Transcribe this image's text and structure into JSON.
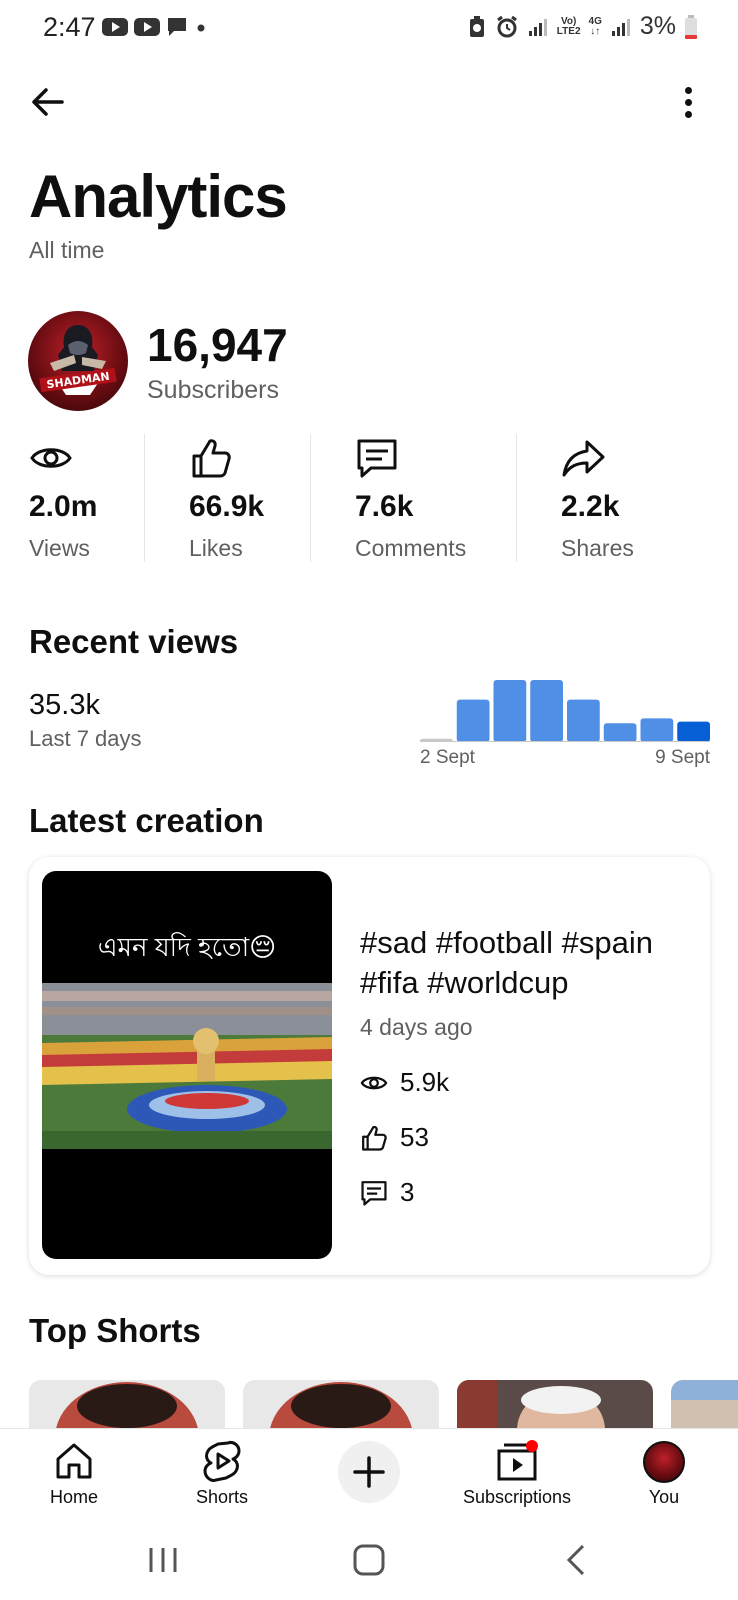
{
  "status_bar": {
    "time": "2:47",
    "battery": "3%",
    "net_volte": "Vo)",
    "net_lte": "LTE2",
    "net_4g": "4G"
  },
  "header": {
    "title": "Analytics",
    "subtitle": "All time"
  },
  "channel": {
    "subscribers": "16,947",
    "subscribers_label": "Subscribers",
    "avatar_text": "SHADMAN"
  },
  "stats": [
    {
      "value": "2.0m",
      "label": "Views",
      "icon": "eye-icon"
    },
    {
      "value": "66.9k",
      "label": "Likes",
      "icon": "thumbs-up-icon"
    },
    {
      "value": "7.6k",
      "label": "Comments",
      "icon": "comment-icon"
    },
    {
      "value": "2.2k",
      "label": "Shares",
      "icon": "share-icon"
    }
  ],
  "recent_views": {
    "title": "Recent views",
    "value": "35.3k",
    "period": "Last 7 days",
    "axis_start": "2 Sept",
    "axis_end": "9 Sept"
  },
  "chart_data": {
    "type": "bar",
    "categories": [
      "2 Sept",
      "3 Sept",
      "4 Sept",
      "5 Sept",
      "6 Sept",
      "7 Sept",
      "8 Sept",
      "9 Sept"
    ],
    "values": [
      0.4,
      5.2,
      7.6,
      7.6,
      5.2,
      2.3,
      2.9,
      2.5
    ],
    "highlight_index": 7,
    "colors": {
      "bar": "#4f8fe6",
      "highlight": "#065fd4",
      "empty": "#c8c8c8"
    }
  },
  "latest_creation": {
    "title": "Latest creation",
    "thumb_caption": "এমন যদি হতো😔",
    "video_title": "#sad #football #spain #fifa #worldcup",
    "age": "4 days ago",
    "views": "5.9k",
    "likes": "53",
    "comments": "3"
  },
  "top_shorts": {
    "title": "Top Shorts"
  },
  "bottom_nav": {
    "home": "Home",
    "shorts": "Shorts",
    "subscriptions": "Subscriptions",
    "you": "You"
  },
  "colors": {
    "accent": "#065fd4",
    "notification_dot": "#ff0000",
    "secondary_text": "#606060"
  }
}
